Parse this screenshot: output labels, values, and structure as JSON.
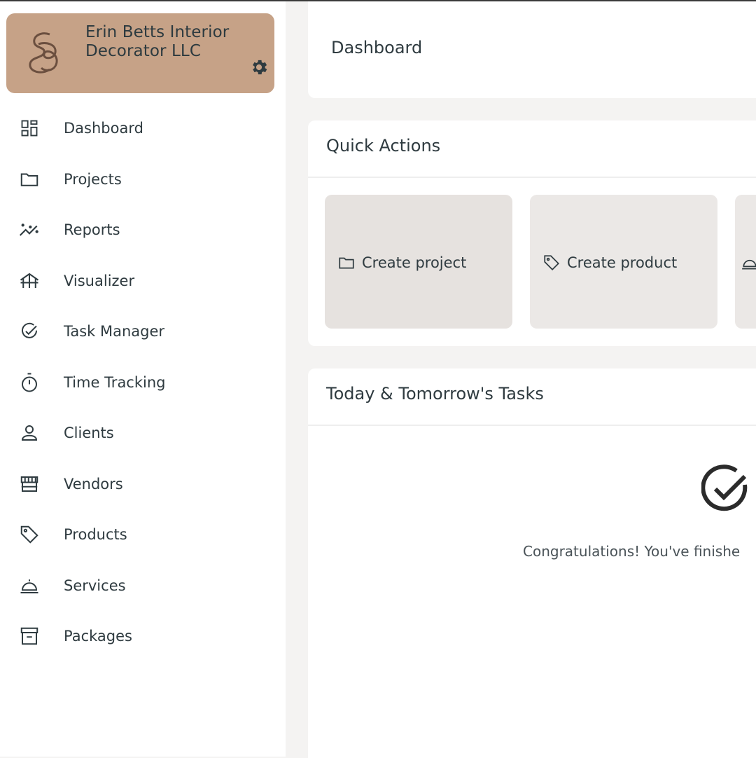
{
  "brand": {
    "name": "Erin Betts Interior Decorator LLC",
    "color": "#c6a287",
    "logo_icon": "eb-monogram-icon",
    "settings_icon": "gear-icon"
  },
  "sidebar": {
    "items": [
      {
        "label": "Dashboard",
        "icon": "dashboard-icon"
      },
      {
        "label": "Projects",
        "icon": "folder-icon"
      },
      {
        "label": "Reports",
        "icon": "chart-line-icon"
      },
      {
        "label": "Visualizer",
        "icon": "visualizer-icon"
      },
      {
        "label": "Task Manager",
        "icon": "check-circle-icon"
      },
      {
        "label": "Time Tracking",
        "icon": "stopwatch-icon"
      },
      {
        "label": "Clients",
        "icon": "user-icon"
      },
      {
        "label": "Vendors",
        "icon": "store-icon"
      },
      {
        "label": "Products",
        "icon": "tag-icon"
      },
      {
        "label": "Services",
        "icon": "cloche-icon"
      },
      {
        "label": "Packages",
        "icon": "archive-icon"
      }
    ]
  },
  "header": {
    "title": "Dashboard"
  },
  "quick_actions": {
    "title": "Quick Actions",
    "buttons": [
      {
        "label": "Create project",
        "icon": "folder-icon"
      },
      {
        "label": "Create product",
        "icon": "tag-icon"
      },
      {
        "label": "",
        "icon": "cloche-icon"
      }
    ]
  },
  "tasks": {
    "title": "Today & Tomorrow's Tasks",
    "empty_icon": "check-circle-icon",
    "empty_message": "Congratulations! You've finishe"
  }
}
